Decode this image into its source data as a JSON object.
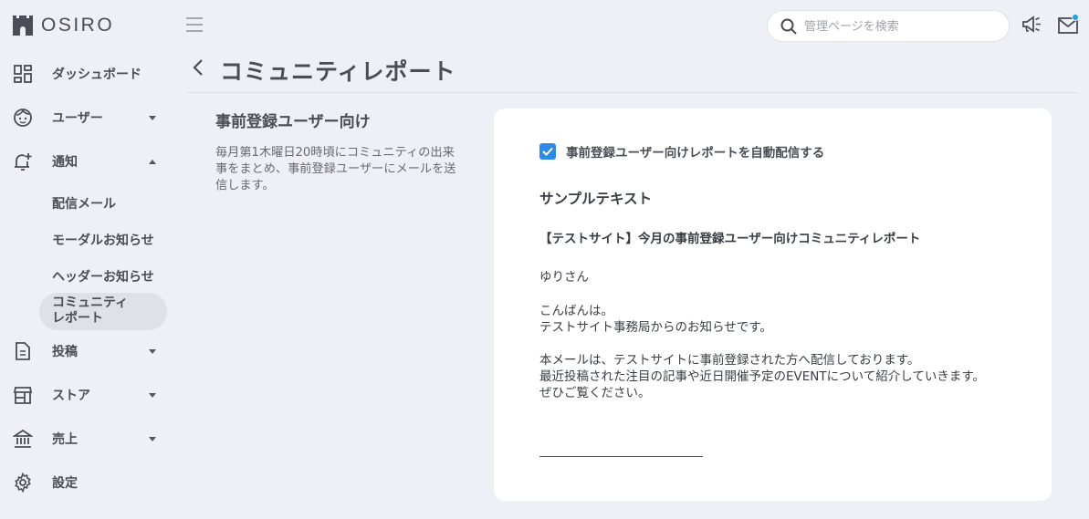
{
  "app": {
    "logo_text": "OSIRO"
  },
  "sidebar": {
    "items": [
      {
        "label": "ダッシュボード",
        "icon": "dashboard-icon"
      },
      {
        "label": "ユーザー",
        "icon": "user-face-icon"
      },
      {
        "label": "通知",
        "icon": "notification-bell-icon"
      },
      {
        "label": "投稿",
        "icon": "document-icon"
      },
      {
        "label": "ストア",
        "icon": "store-icon"
      },
      {
        "label": "売上",
        "icon": "bank-icon"
      },
      {
        "label": "設定",
        "icon": "gear-icon"
      }
    ],
    "notification_sub": [
      {
        "label": "配信メール"
      },
      {
        "label": "モーダルお知らせ"
      },
      {
        "label": "ヘッダーお知らせ"
      },
      {
        "label_line1": "コミュニティ",
        "label_line2": "レポート",
        "active": true
      }
    ]
  },
  "header": {
    "search_placeholder": "管理ページを検索",
    "notification_dot_color": "#1aa3e8"
  },
  "page": {
    "title": "コミュニティレポート",
    "section_title": "事前登録ユーザー向け",
    "section_desc_1": "毎月第1木曜日20時頃にコミュニティの出来",
    "section_desc_2": "事をまとめ、事前登録ユーザーにメールを送",
    "section_desc_3": "信します。"
  },
  "card": {
    "checkbox_label": "事前登録ユーザー向けレポートを自動配信する",
    "checkbox_checked": true,
    "sample_title": "サンプルテキスト",
    "mail_subject": "【テストサイト】今月の事前登録ユーザー向けコミュニティレポート",
    "mail_lines": [
      "ゆりさん",
      "こんばんは。",
      "テストサイト事務局からのお知らせです。",
      "本メールは、テストサイトに事前登録された方へ配信しております。",
      "最近投稿された注目の記事や近日開催予定のEVENTについて紹介していきます。",
      "ぜひご覧ください。"
    ]
  },
  "colors": {
    "accent": "#2d8ae6",
    "background": "#eef0f5",
    "card": "#ffffff"
  }
}
